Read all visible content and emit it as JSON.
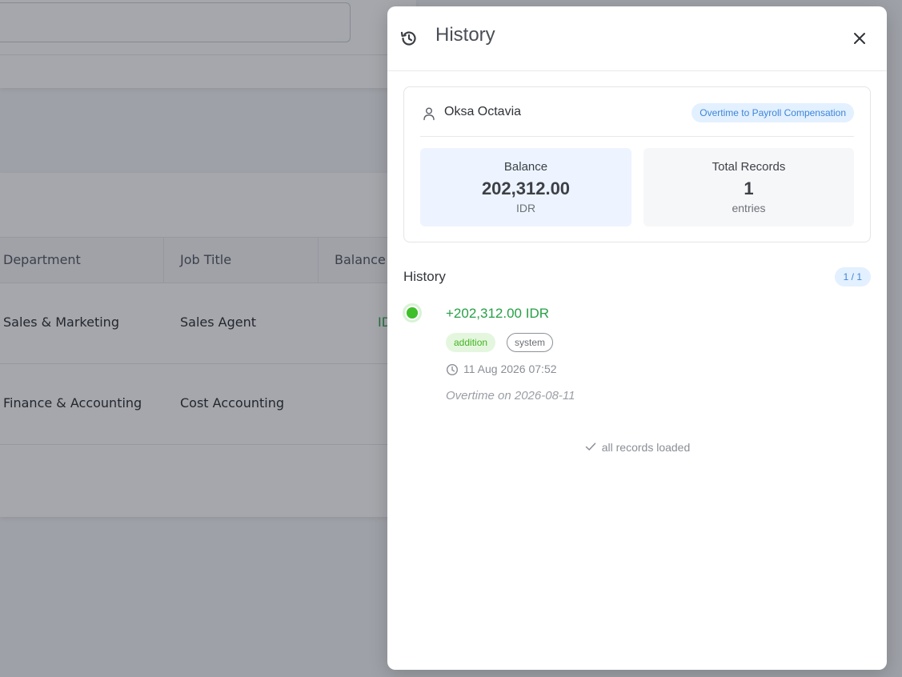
{
  "background": {
    "table": {
      "headers": [
        "Department",
        "Job Title",
        "Balance"
      ],
      "rows": [
        {
          "department": "Sales & Marketing",
          "job_title": "Sales Agent",
          "balance": "ID"
        },
        {
          "department": "Finance & Accounting",
          "job_title": "Cost Accounting",
          "balance": ""
        }
      ]
    }
  },
  "drawer": {
    "title": "History",
    "header_icon": "history-icon",
    "close_icon": "close-icon",
    "employee": {
      "name": "Oksa Octavia",
      "icon": "user-icon",
      "badge": "Overtime to Payroll Compensation"
    },
    "balance": {
      "label": "Balance",
      "value": "202,312.00",
      "unit": "IDR"
    },
    "total_records": {
      "label": "Total Records",
      "value": "1",
      "unit": "entries"
    },
    "history": {
      "title": "History",
      "page": "1 / 1",
      "entries": [
        {
          "amount": "+202,312.00 IDR",
          "tags": [
            "addition",
            "system"
          ],
          "time": "11 Aug 2026 07:52",
          "note": "Overtime on 2026-08-11"
        }
      ],
      "footer": "all records loaded"
    }
  },
  "colors": {
    "accent_blue": "#3d86d8",
    "positive_green": "#27a046",
    "dot_green": "#3fbf2a"
  }
}
